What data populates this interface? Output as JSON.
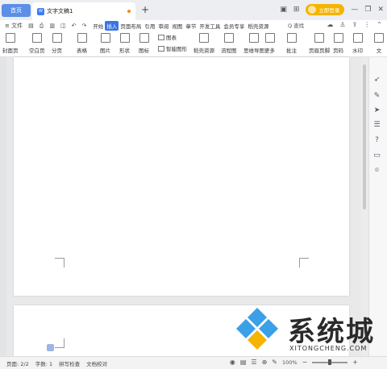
{
  "titlebar": {
    "home_tab": "首页",
    "doc_tab": "文字文稿1",
    "doc_icon_label": "W",
    "add_tab": "+",
    "login": "立即登录"
  },
  "menubar": {
    "file": "≡ 文件",
    "tabs": [
      "开始",
      "插入",
      "页面布局",
      "引用",
      "审阅",
      "视图",
      "章节",
      "开发工具",
      "会员专享",
      "稻壳资源"
    ],
    "active_tab": "插入",
    "search": "Q 查找"
  },
  "ribbon": {
    "items": [
      "封面页",
      "空白页",
      "分页",
      "表格",
      "图片",
      "形状",
      "图标",
      "图表",
      "智能图形",
      "稻壳资源",
      "流程图",
      "思维导图",
      "更多",
      "批注",
      "页眉页脚",
      "页码",
      "水印",
      "文"
    ]
  },
  "statusbar": {
    "page": "页面: 2/2",
    "words": "字数: 1",
    "spell": "拼写检查",
    "proof": "文档校对",
    "zoom": "100%"
  },
  "watermark": {
    "brand": "系统城",
    "domain": "XITONGCHENG.COM"
  },
  "colors": {
    "accent": "#3b73e6",
    "login": "#f4b400",
    "home_tab": "#5b8fe8"
  }
}
